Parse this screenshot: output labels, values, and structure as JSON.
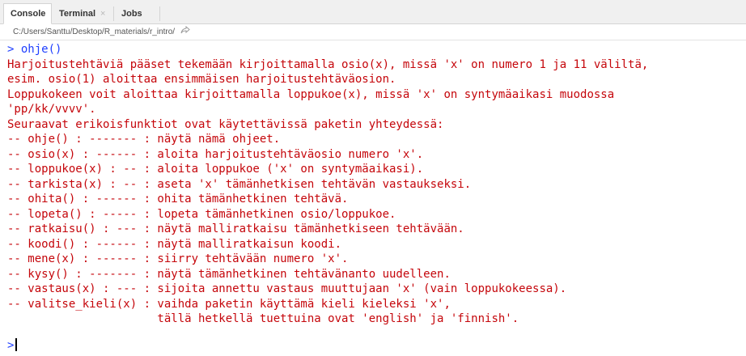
{
  "tabs": [
    {
      "label": "Console",
      "active": true,
      "closable": false
    },
    {
      "label": "Terminal",
      "active": false,
      "closable": true
    },
    {
      "label": "Jobs",
      "active": false,
      "closable": true
    }
  ],
  "tab_close_glyph": "×",
  "path": "C:/Users/Santtu/Desktop/R_materials/r_intro/",
  "console": {
    "prompt": ">",
    "command": " ohje()",
    "output_lines": [
      "Harjoitustehtäviä pääset tekemään kirjoittamalla osio(x), missä 'x' on numero 1 ja 11 väliltä,",
      "esim. osio(1) aloittaa ensimmäisen harjoitustehtäväosion.",
      "Loppukokeen voit aloittaa kirjoittamalla loppukoe(x), missä 'x' on syntymäaikasi muodossa",
      "'pp/kk/vvvv'.",
      "Seuraavat erikoisfunktiot ovat käytettävissä paketin yhteydessä:",
      "-- ohje() : ------- : näytä nämä ohjeet.",
      "-- osio(x) : ------ : aloita harjoitustehtäväosio numero 'x'.",
      "-- loppukoe(x) : -- : aloita loppukoe ('x' on syntymäaikasi).",
      "-- tarkista(x) : -- : aseta 'x' tämänhetkisen tehtävän vastaukseksi.",
      "-- ohita() : ------ : ohita tämänhetkinen tehtävä.",
      "-- lopeta() : ----- : lopeta tämänhetkinen osio/loppukoe.",
      "-- ratkaisu() : --- : näytä malliratkaisu tämänhetkiseen tehtävään.",
      "-- koodi() : ------ : näytä malliratkaisun koodi.",
      "-- mene(x) : ------ : siirry tehtävään numero 'x'.",
      "-- kysy() : ------- : näytä tämänhetkinen tehtävänanto uudelleen.",
      "-- vastaus(x) : --- : sijoita annettu vastaus muuttujaan 'x' (vain loppukokeessa).",
      "-- valitse_kieli(x) : vaihda paketin käyttämä kieli kieleksi 'x',",
      "                      tällä hetkellä tuettuina ovat 'english' ja 'finnish'."
    ],
    "empty_prompt": ">"
  },
  "colors": {
    "prompt": "#1f3fff",
    "output": "#c5060b"
  },
  "icons": {
    "path_link": "share-arrow-icon"
  }
}
